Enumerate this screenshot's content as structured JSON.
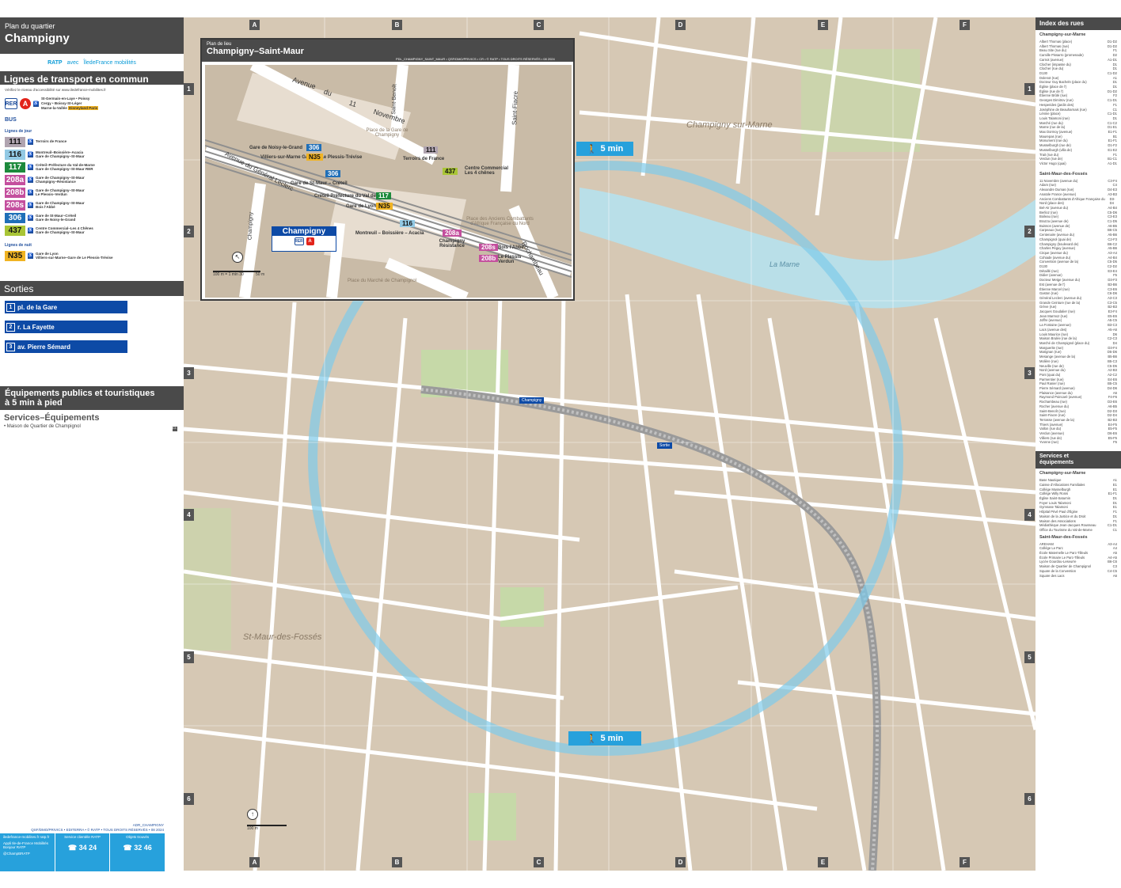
{
  "sidebar": {
    "plan_label": "Plan du quartier",
    "city": "Champigny",
    "logos": {
      "ratp": "RATP",
      "avec": "avec",
      "idf": "ÎledeFrance mobilités"
    },
    "transport_title": "Lignes de transport en commun",
    "accessibility_note": "Vérifiez le niveau d'accessibilité sur www.iledefrance-mobilites.fr",
    "rer": {
      "label": "RER",
      "line": "A",
      "destinations": [
        "St-Germain-en-Laye • Poissy",
        "Cergy • Boissy-St-Léger",
        "Marne-la-Vallée"
      ],
      "extra": "Disneyland Paris"
    },
    "bus_label": "BUS",
    "day_lines_label": "Lignes de jour",
    "night_lines_label": "Lignes de nuit",
    "bus_lines": [
      {
        "num": "111",
        "color": "#b0a4b0",
        "dest": [
          "Terroirs de France"
        ]
      },
      {
        "num": "116",
        "color": "#92c9e4",
        "dest": [
          "Montreuil–Boissière–Acacia",
          "Gare de Champigny–St-Maur"
        ]
      },
      {
        "num": "117",
        "color": "#1d8a3c",
        "text_color": "#ffffff",
        "dest": [
          "Créteil–Préfecture du Val-de-Marne",
          "Gare de Champigny–St-Maur RER"
        ]
      },
      {
        "num": "208a",
        "color": "#c44f9e",
        "text_color": "#ffffff",
        "dest": [
          "Gare de Champigny–St-Maur",
          "Champigny–Résistance"
        ]
      },
      {
        "num": "208b",
        "color": "#c44f9e",
        "text_color": "#ffffff",
        "dest": [
          "Gare de Champigny–St-Maur",
          "Le Plessis–Verdun"
        ]
      },
      {
        "num": "208s",
        "color": "#c44f9e",
        "text_color": "#ffffff",
        "dest": [
          "Gare de Champigny–St-Maur",
          "Bois l'Abbé"
        ]
      },
      {
        "num": "306",
        "color": "#1f6fb8",
        "text_color": "#ffffff",
        "dest": [
          "Gare de St-Maur–Créteil",
          "Gare de Noisy-le-Grand"
        ]
      },
      {
        "num": "437",
        "color": "#a9c536",
        "dest": [
          "Centre Commercial–Les 4 Chênes",
          "Gare de Champigny–St-Maur"
        ]
      }
    ],
    "night_lines": [
      {
        "num": "N35",
        "color": "#f0b323",
        "dest": [
          "Gare de Lyon",
          "Villiers-sur-Marne–Gare de Le Plessis-Trévise"
        ]
      }
    ],
    "sorties_title": "Sorties",
    "exits": [
      {
        "n": "1",
        "label": "pl. de la Gare"
      },
      {
        "n": "2",
        "label": "r. La Fayette"
      },
      {
        "n": "3",
        "label": "av. Pierre Sémard"
      }
    ],
    "equip_title_1": "Équipements publics et touristiques",
    "equip_title_2": "à 5 min à pied",
    "services_title": "Services–Équipements",
    "services_item": "• Maison de Quartier de Champignol",
    "services_ref": "C3",
    "footer_meta_1": "ADR_CHAMPIGNY",
    "footer_meta_2": "QSF/DMO/PRIVICS • EDITERRA • © RATP • TOUS DROITS RÉSERVÉS • 08 2024",
    "footer": {
      "web": "iledefrance-mobilites.fr ratp.fr",
      "apps": "Appli Ile-de-France Mobilités Bonjour RATP",
      "twitter": "@ChampBRATP",
      "service_client": "Service clientèle RATP",
      "phone1": "34 24",
      "objets": "Objets trouvés",
      "phone2": "32 46"
    }
  },
  "map": {
    "grid_cols": [
      "A",
      "B",
      "C",
      "D",
      "E",
      "F"
    ],
    "grid_rows": [
      "1",
      "2",
      "3",
      "4",
      "5",
      "6"
    ],
    "walk_label": "5 min",
    "places": [
      "Champigny sur-Marne",
      "St-Maur-des-Fossés",
      "La Marne"
    ],
    "station_label": "Champigny",
    "exit_sortie": "Sortie",
    "scale": "100 m",
    "scale_walk": "100 m = 1 min 30"
  },
  "inset": {
    "sub": "Plan de lieu",
    "title": "Champigny–Saint-Maur",
    "meta": "PDL_CHAMPIGNY_SAINT_MAUR • QSF/DMO/PRIVICS • CR • © RATP • TOUS DROITS RÉSERVÉS • 08 2024",
    "stops": [
      {
        "label": "Gare de Noisy-le-Grand",
        "num": "306"
      },
      {
        "label": "Villiers-sur-Marne Gare de Le Plessis-Trévise",
        "num": "N35"
      },
      {
        "label": "Gare de St-Maur – Créteil",
        "num": "306"
      },
      {
        "label": "Créteil Préfecture du Val de Marne",
        "num": "117"
      },
      {
        "label": "Gare de Lyon",
        "num": "N35"
      },
      {
        "label": "Terroirs de France",
        "num": "111"
      },
      {
        "label": "Centre Commercial Les 4 chênes",
        "num": "437"
      },
      {
        "label": "Montreuil – Boissière – Acacia",
        "num": "116"
      },
      {
        "label": "Champigny Résistance",
        "num": "208a"
      },
      {
        "label": "Bois l'Abbé",
        "num": "208s"
      },
      {
        "label": "Le Plessis Verdun",
        "num": "208b"
      }
    ],
    "streets": [
      "Avenue",
      "du",
      "11",
      "Novembre",
      "Rue",
      "Saint-Benoît",
      "Saint-Fiacre",
      "Place de la Gare de Champigny",
      "Avenue du Général Leclerc",
      "Champigny",
      "Bd de",
      "Adam",
      "Place des Anciens Combattants d'Afrique Française du Nord",
      "Rue de la Fayette",
      "Rochambeau",
      "Place du Marché de Champignol"
    ],
    "station": "Champigny",
    "scale": "50 m",
    "scale_walk": "100 m = 1 min 30"
  },
  "index": {
    "title": "Index des rues",
    "sub1": "Champigny-sur-Marne",
    "streets_1": [
      [
        "Albert Thomas (place)",
        "D1-D2"
      ],
      [
        "Albert Thomas (rue)",
        "D1-D2"
      ],
      [
        "Beau Site (rue du)",
        "F1"
      ],
      [
        "Camille Pissarro (promenade)",
        "D2"
      ],
      [
        "Carnot (avenue)",
        "A1-D1"
      ],
      [
        "Clocher (impasse du)",
        "D1"
      ],
      [
        "Clocher (rue du)",
        "D1"
      ],
      [
        "D130",
        "C1-D2"
      ],
      [
        "Dolenot (rue)",
        "A1"
      ],
      [
        "Docteur Guy Bacheln (place du)",
        "D1"
      ],
      [
        "Église (place de l')",
        "D1"
      ],
      [
        "Église (rue de l')",
        "D1-D2"
      ],
      [
        "Étienne Brûlé (rue)",
        "F2"
      ],
      [
        "Georges Dimitrov (rue)",
        "C1-D1"
      ],
      [
        "Hesperides (jardin des)",
        "F1"
      ],
      [
        "Joséphine de Beauharnais (rue)",
        "C1"
      ],
      [
        "Lénine (place)",
        "C1-D1"
      ],
      [
        "Louis Talamoni (rue)",
        "D1"
      ],
      [
        "Marché (rue du)",
        "C1-C2"
      ],
      [
        "Marne (rue de la)",
        "D1-E1"
      ],
      [
        "Max Dormoy (avenue)",
        "E1-F1"
      ],
      [
        "Maurepas (rue)",
        "B1"
      ],
      [
        "Monument (rue du)",
        "E1-F1"
      ],
      [
        "Musselburgh (rue de)",
        "D1-F2"
      ],
      [
        "Musselburgh (villa de)",
        "E1-E2"
      ],
      [
        "Trait (rue du)",
        "F1"
      ],
      [
        "Verdun (rue de)",
        "B1-C1"
      ],
      [
        "Victor Hugo (quai)",
        "A1-D1"
      ]
    ],
    "sub2": "Saint-Maur-des-Fossés",
    "streets_2": [
      [
        "11 Novembre (avenue du)",
        "C3-F4"
      ],
      [
        "Adam (rue)",
        "C4"
      ],
      [
        "Alexandre Dumas (rue)",
        "D4-E3"
      ],
      [
        "Anatole France (avenue)",
        "A3-B3"
      ],
      [
        "Anciens Combattants d'Afrique Française du Nord (place des)",
        "D3-D4"
      ],
      [
        "Bel-Air (avenue du)",
        "A4-B4"
      ],
      [
        "Berlioz (rue)",
        "C5-D6"
      ],
      [
        "Boileau (rue)",
        "C3-E3"
      ],
      [
        "Brazza (avenue de)",
        "C1-D5"
      ],
      [
        "Buisson (avenue de)",
        "A6-B5"
      ],
      [
        "Carpeaux (rue)",
        "B6-C5"
      ],
      [
        "Centenaire (avenue du)",
        "A5-B6"
      ],
      [
        "Champignol (quai de)",
        "C2-F3"
      ],
      [
        "Champigny (boulevard de)",
        "B6-C2"
      ],
      [
        "Charles Péguy (avenue)",
        "A5-B6"
      ],
      [
        "Cirque (avenue du)",
        "A3-A4"
      ],
      [
        "Cohiade (avenue du)",
        "A4-B4"
      ],
      [
        "Convention (avenue de la)",
        "C5-D5"
      ],
      [
        "D130",
        "C2-D2"
      ],
      [
        "Détaillé (rue)",
        "E3-E4"
      ],
      [
        "Didier (avenue)",
        "F5"
      ],
      [
        "Docteur Metge (avenue du)",
        "D3-F3"
      ],
      [
        "Est (avenue de l')",
        "B3-B6"
      ],
      [
        "Étienne Marcel (rue)",
        "C3-E6"
      ],
      [
        "Gaston (rue)",
        "C6-D6"
      ],
      [
        "Général Leclerc (avenue du)",
        "A3-C3"
      ],
      [
        "Grande Ceinture (rue de la)",
        "C3-C5"
      ],
      [
        "Grève (rue)",
        "B2-B3"
      ],
      [
        "Jacques Goudalier (rue)",
        "E3-F4"
      ],
      [
        "Jean Marmoz (rue)",
        "E5-E6"
      ],
      [
        "Joffre (avenue)",
        "A5-C5"
      ],
      [
        "La Fontaine (avenue)",
        "B3-C3"
      ],
      [
        "Lacs (avenue des)",
        "A5-A6"
      ],
      [
        "Louis Maurice (rue)",
        "D6"
      ],
      [
        "Maison Brulée (rue de la)",
        "C2-C3"
      ],
      [
        "Marché de Champignol (place du)",
        "D4"
      ],
      [
        "Marguerite (rue)",
        "D3-F4"
      ],
      [
        "Marignan (rue)",
        "D5-D6"
      ],
      [
        "Mesange (avenue de la)",
        "B5-B6"
      ],
      [
        "Molière (rue)",
        "B5-C3"
      ],
      [
        "Neuville (rue de)",
        "C5-D5"
      ],
      [
        "Nord (avenue du)",
        "A2-B3"
      ],
      [
        "Pont (quai du)",
        "A2-C2"
      ],
      [
        "Parmentier (rue)",
        "E4-E6"
      ],
      [
        "Paul Ranier (rue)",
        "B5-C5"
      ],
      [
        "Pierre Sémard (avenue)",
        "D4-D6"
      ],
      [
        "Plaisance (avenue du)",
        "A6"
      ],
      [
        "Raymond Poincaré (avenue)",
        "F4-F6"
      ],
      [
        "Rochambeau (rue)",
        "D3-E6"
      ],
      [
        "Rocher (avenue du)",
        "A6-B5"
      ],
      [
        "Saint-Benoît (rue)",
        "D2-D3"
      ],
      [
        "Saint-Fiacre (rue)",
        "D2-D4"
      ],
      [
        "Terrasse (avenue de la)",
        "B2-B3"
      ],
      [
        "Thiers (avenue)",
        "E4-F5"
      ],
      [
        "Vallon (rue du)",
        "E5-F5"
      ],
      [
        "Verdun (avenue)",
        "D6-E6"
      ],
      [
        "Villiers (rue de)",
        "E5-F5"
      ],
      [
        "Yvonne (rue)",
        "F5"
      ]
    ],
    "serv_title_1": "Services et",
    "serv_title_2": "équipements",
    "serv_sub1": "Champigny-sur-Marne",
    "services_1": [
      [
        "Base Nautique",
        "A1"
      ],
      [
        "Caisse d'Allocations Familiales",
        "E1"
      ],
      [
        "Collège Musselburgh",
        "E1"
      ],
      [
        "Collège Willy Ronis",
        "E1-F1"
      ],
      [
        "Église Saint-Saturnin",
        "D1"
      ],
      [
        "Foyer Louis Talamoni",
        "D1"
      ],
      [
        "Gymnase Talamoni",
        "E1"
      ],
      [
        "Hôpital Privé Paul d'Égine",
        "F1"
      ],
      [
        "Maison de la Justice et du Droit",
        "D1"
      ],
      [
        "Maison des Associations",
        "F1"
      ],
      [
        "Médiathèque Jean-Jacques Rousseau",
        "C1-D1"
      ],
      [
        "Office du Tourisme du Val-de-Marne",
        "C1"
      ]
    ],
    "serv_sub2": "Saint-Maur-des-Fossés",
    "services_2": [
      [
        "AREHAM",
        "A3-A4"
      ],
      [
        "Collège Le Parc",
        "A4"
      ],
      [
        "École Maternelle Le Parc-Tilleuls",
        "A5"
      ],
      [
        "École Primaire Le Parc-Tilleuls",
        "A4-A5"
      ],
      [
        "Lycée Gourdou-Leseurre",
        "B6-C6"
      ],
      [
        "Maison de Quartier de Champignol",
        "C3"
      ],
      [
        "Square de la Convention",
        "C4-C5"
      ],
      [
        "Square des Lacs",
        "A6"
      ]
    ]
  },
  "colors": {
    "blue": "#0d4aa6",
    "light_blue": "#27a1dc",
    "dark": "#4a4a4a",
    "map_bg": "#d6c8b4",
    "water": "#b9dfe8",
    "park": "#c6d9a8"
  }
}
